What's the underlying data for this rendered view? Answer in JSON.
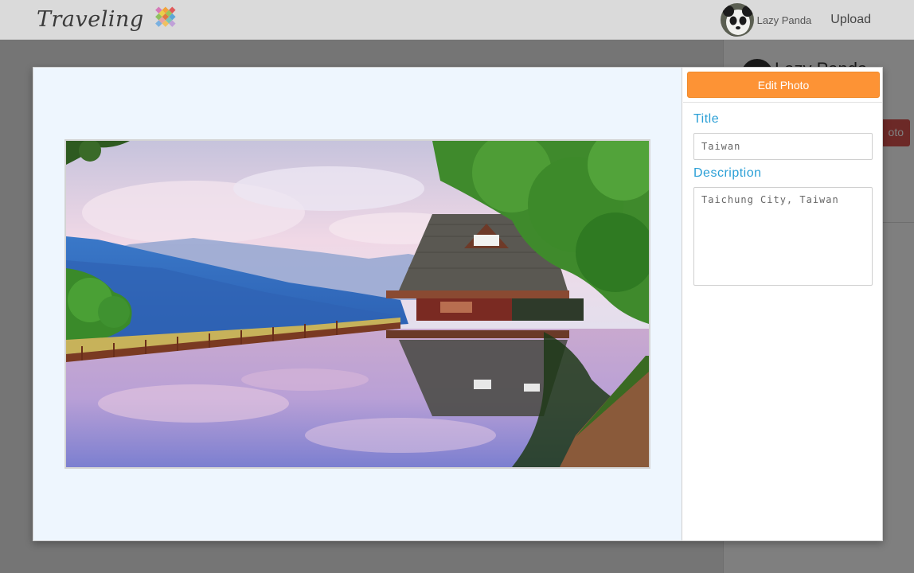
{
  "navbar": {
    "brand": "Traveling",
    "username": "Lazy Panda",
    "upload_label": "Upload"
  },
  "background_page": {
    "profile_name": "Lazy Panda",
    "action_button_partial": "oto"
  },
  "modal": {
    "edit_button_label": "Edit Photo",
    "title_label": "Title",
    "title_value": "Taiwan",
    "description_label": "Description",
    "description_value": "Taichung City, Taiwan"
  },
  "colors": {
    "accent_orange": "#fd9335",
    "label_blue": "#2a9fd6",
    "danger_red": "#d9534f"
  },
  "icons": {
    "brand_logo": "mosaic-tree-logo-icon",
    "avatar": "panda-avatar"
  }
}
